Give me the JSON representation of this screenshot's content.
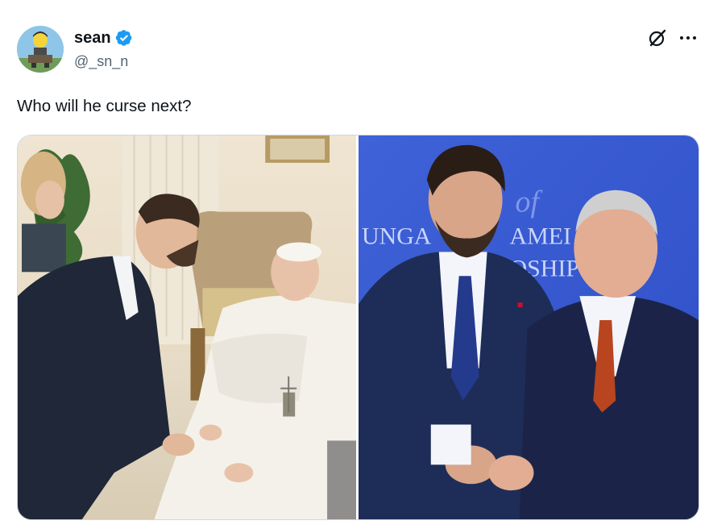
{
  "tweet": {
    "author": {
      "display_name": "sean",
      "handle": "@_sn_n",
      "verified": true
    },
    "text": "Who will he curse next?",
    "media": [
      {
        "icon": "photo",
        "alt_visible": false
      },
      {
        "icon": "photo",
        "alt_visible": false
      }
    ],
    "backdrop_text": [
      "UNGA",
      "AMEI",
      "OSHIP"
    ]
  },
  "colors": {
    "verified_badge": "#1d9bf0",
    "text_primary": "#0f1419",
    "text_secondary": "#536471"
  },
  "icons": {
    "header_action": "grok-icon",
    "more": "more-icon"
  }
}
